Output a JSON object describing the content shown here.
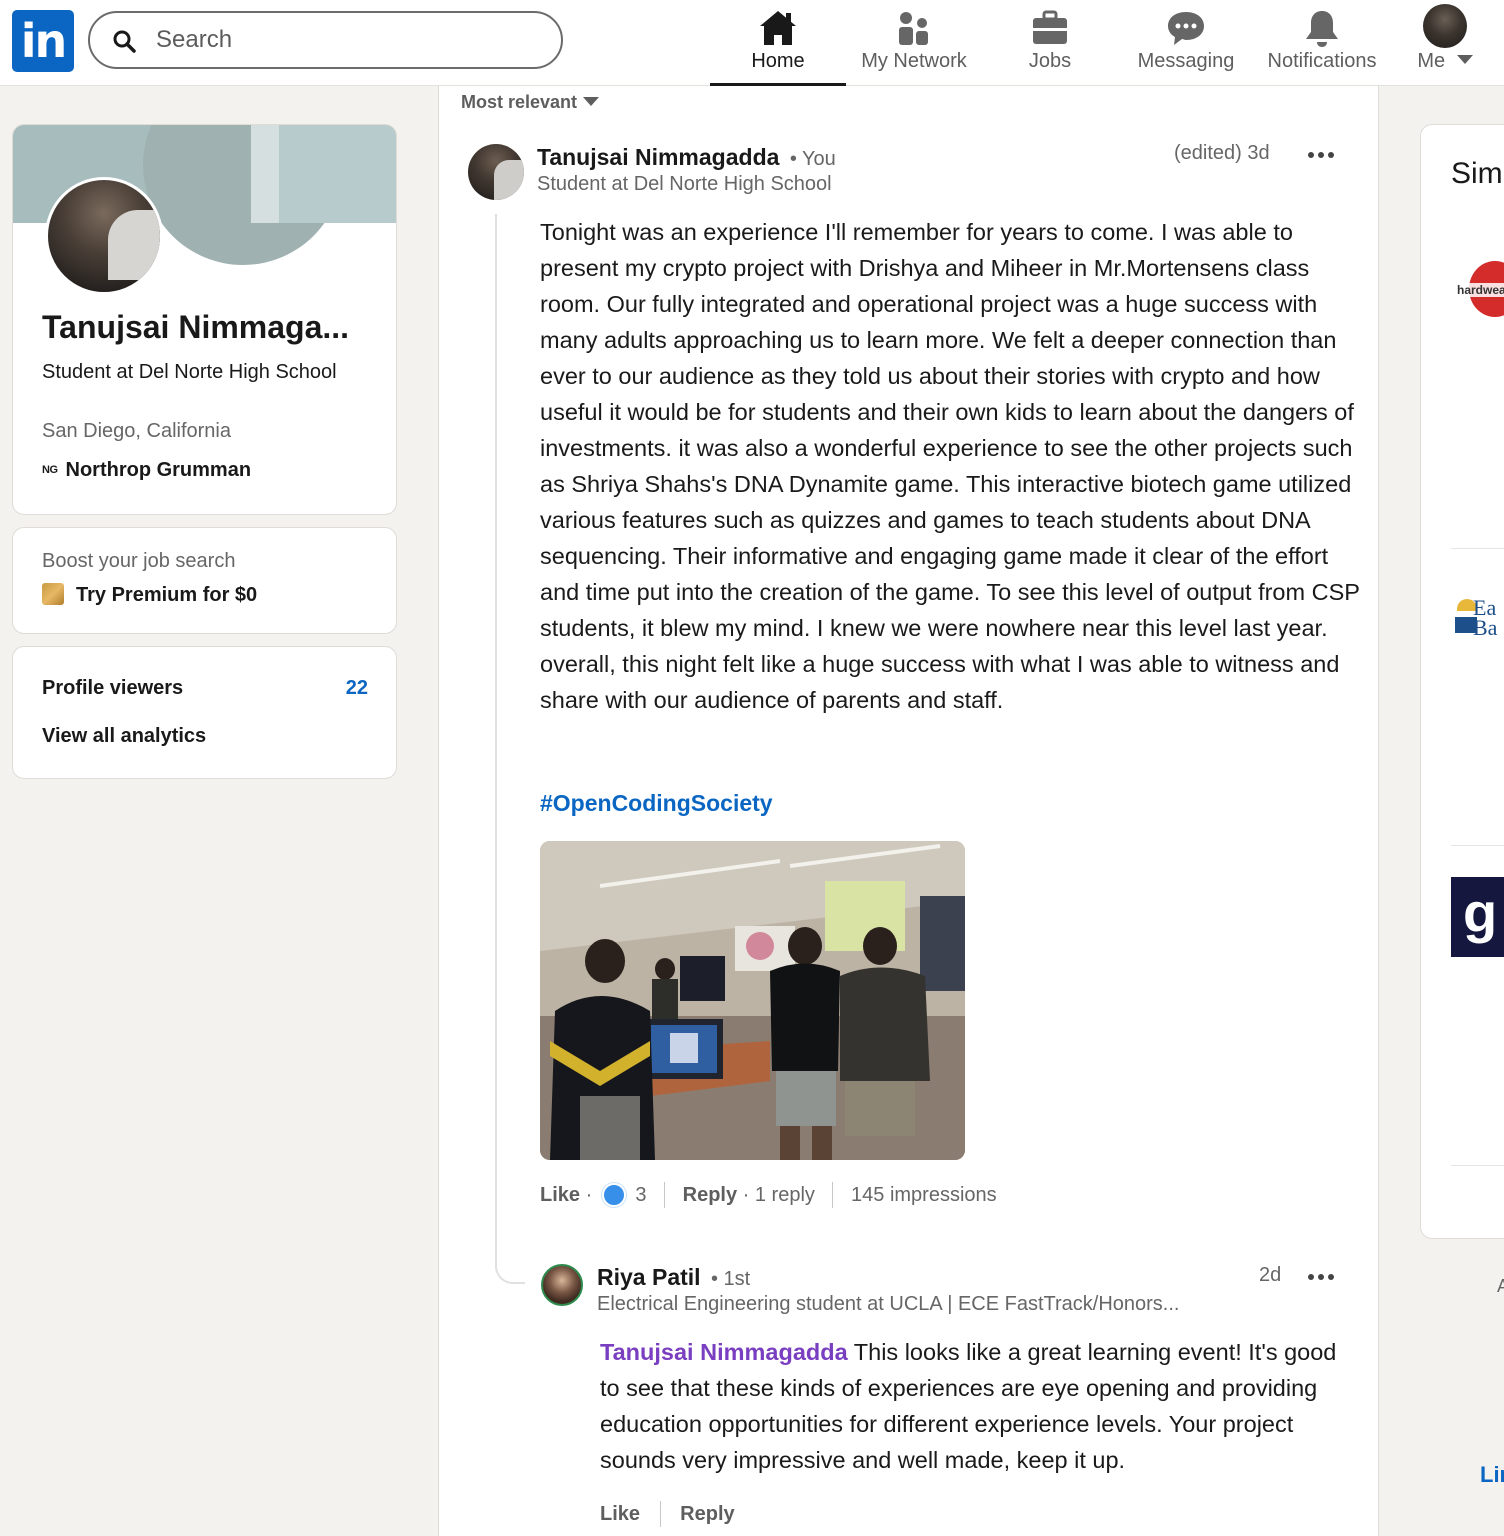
{
  "nav": {
    "logo_text": "in",
    "search_placeholder": "Search",
    "items": [
      {
        "label": "Home",
        "icon": "home-icon",
        "active": true
      },
      {
        "label": "My Network",
        "icon": "network-icon",
        "active": false
      },
      {
        "label": "Jobs",
        "icon": "briefcase-icon",
        "active": false
      },
      {
        "label": "Messaging",
        "icon": "messaging-icon",
        "active": false
      },
      {
        "label": "Notifications",
        "icon": "bell-icon",
        "active": false
      },
      {
        "label": "Me",
        "icon": "avatar",
        "active": false
      }
    ]
  },
  "profile": {
    "name": "Tanujsai Nimmaga...",
    "headline": "Student at Del Norte High School",
    "location": "San Diego, California",
    "company_logo_text": "NG",
    "company": "Northrop Grumman"
  },
  "premium": {
    "boost": "Boost your job search",
    "cta": "Try Premium for $0"
  },
  "analytics": {
    "viewers_label": "Profile viewers",
    "viewers_count": "22",
    "view_all": "View all analytics"
  },
  "feed": {
    "sort_label": "Most relevant",
    "comment": {
      "author": "Tanujsai Nimmagadda",
      "you_tag": "• You",
      "headline": "Student at Del Norte High School",
      "time": "(edited) 3d",
      "text": "Tonight was an experience I'll remember for years to come. I was able to present my crypto project with Drishya and Miheer in Mr.Mortensens class room. Our fully integrated and operational project was a huge success with many adults approaching us to learn more. We felt a deeper connection than ever to our audience as they told us about their stories with crypto and how useful it would be for students and their own kids to learn about the dangers of investments. it was also a wonderful experience to see the other projects such as Shriya Shahs's DNA Dynamite game. This interactive biotech game utilized various features such as quizzes and games to teach students about DNA sequencing. Their informative and engaging game made it clear of the effort and time put into the creation of the game. To see this level of output from CSP students, it blew my mind. I knew we were nowhere near this level last year. overall, this night felt like a huge success with what I was able to witness and share with our audience of parents and staff.",
      "hashtag": "#OpenCodingSociety",
      "like_label": "Like",
      "like_count": "3",
      "reply_label": "Reply",
      "reply_count": "1 reply",
      "impressions": "145 impressions"
    },
    "reply": {
      "author": "Riya Patil",
      "degree": "• 1st",
      "headline": "Electrical Engineering student at UCLA | ECE FastTrack/Honors...",
      "time": "2d",
      "mention": "Tanujsai Nimmagadda",
      "text": " This looks like a great learning event! It's good to see that these kinds of experiences are eye opening and providing education opportunities for different experience levels. Your project sounds very impressive and well made, keep it up.",
      "like_label": "Like",
      "reply_label": "Reply"
    }
  },
  "right": {
    "title_partial": "Simi",
    "logo1_text": "hardwea",
    "logo2_line1": "Ea",
    "logo2_line2": "Ba",
    "logo3_text": "g",
    "edge_text": "A",
    "link_partial": "Lir"
  },
  "colors": {
    "brand": "#0a66c2",
    "mention": "#7a3fc0",
    "background": "#f4f2ee"
  }
}
